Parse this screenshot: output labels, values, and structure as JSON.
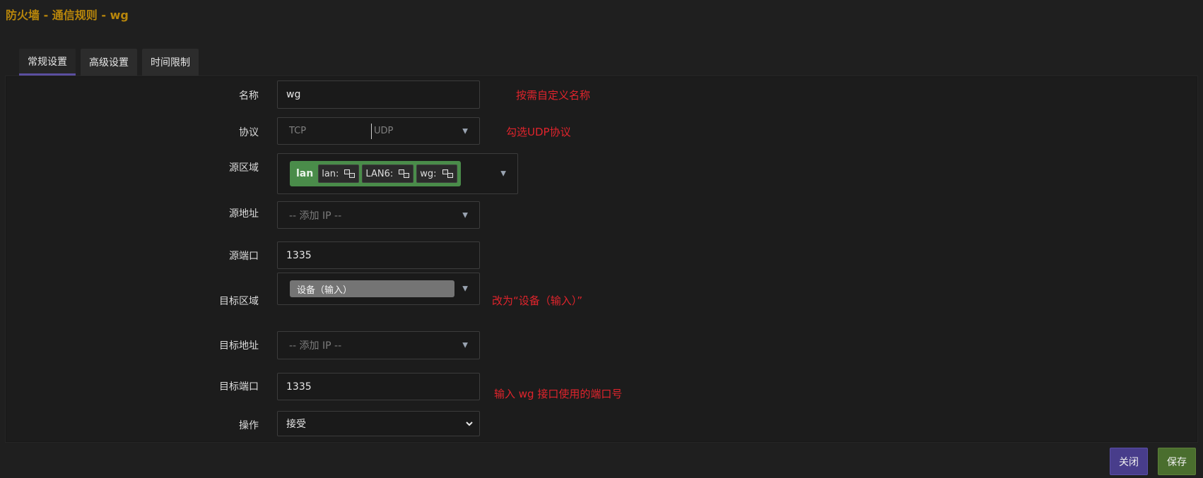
{
  "header": {
    "title": "防火墙 - 通信规则 - wg"
  },
  "tabs": [
    {
      "label": "常规设置",
      "active": true
    },
    {
      "label": "高级设置",
      "active": false
    },
    {
      "label": "时间限制",
      "active": false
    }
  ],
  "form": {
    "name": {
      "label": "名称",
      "value": "wg",
      "note": "按需自定义名称"
    },
    "protocol": {
      "label": "协议",
      "left": "TCP",
      "right": "UDP",
      "note": "勾选UDP协议"
    },
    "src_zone": {
      "label": "源区域",
      "zone": "lan",
      "interfaces": [
        "lan:",
        "LAN6:",
        "wg:"
      ]
    },
    "src_addr": {
      "label": "源地址",
      "placeholder": "-- 添加 IP --"
    },
    "src_port": {
      "label": "源端口",
      "value": "1335"
    },
    "dest_zone": {
      "label": "目标区域",
      "value": "设备（输入）",
      "note": "改为“设备（输入）”"
    },
    "dest_addr": {
      "label": "目标地址",
      "placeholder": "-- 添加 IP --"
    },
    "dest_port": {
      "label": "目标端口",
      "value": "1335",
      "note": "输入 wg 接口使用的端口号"
    },
    "action": {
      "label": "操作",
      "value": "接受"
    }
  },
  "footer": {
    "close_label": "关闭",
    "save_label": "保存"
  },
  "colors": {
    "accent": "#5b4fa0",
    "zone_green": "#4a8c4a",
    "annotation_red": "#e0242c",
    "title_gold": "#b8860b"
  }
}
